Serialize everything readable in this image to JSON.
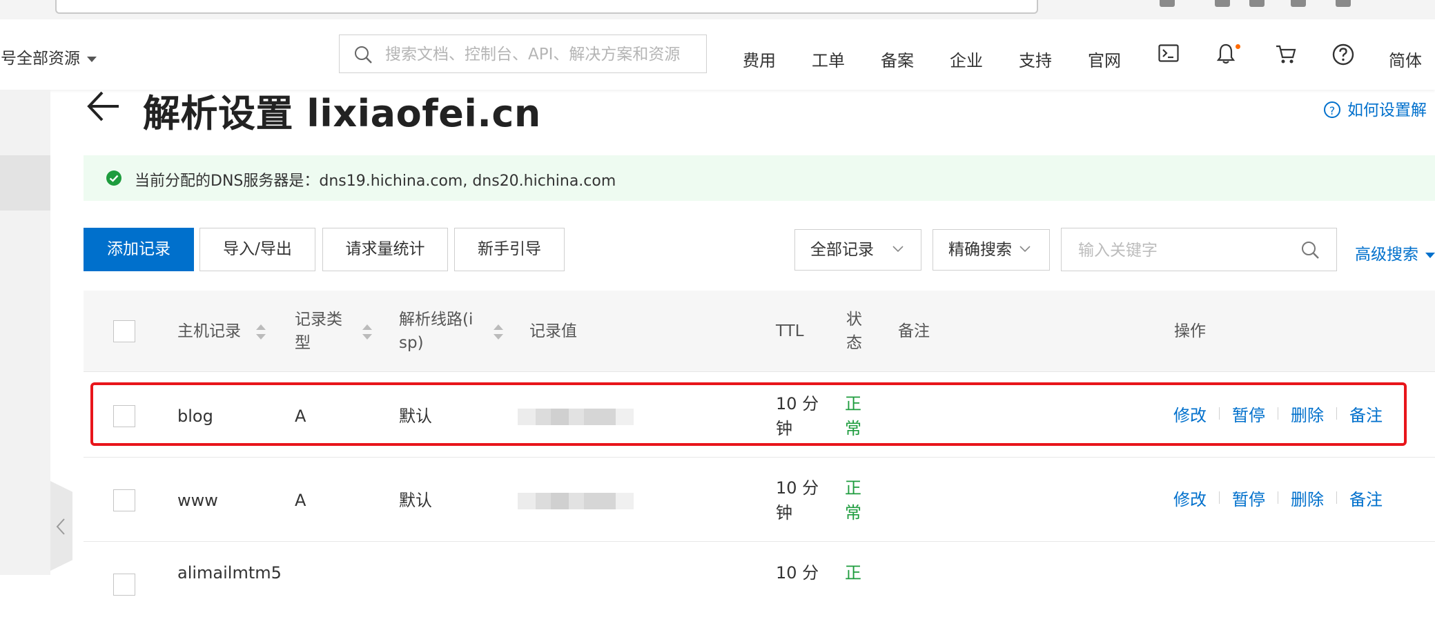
{
  "topbar": {
    "account_switch": "账号全部资源",
    "search_placeholder": "搜索文档、控制台、API、解决方案和资源",
    "nav": [
      "费用",
      "工单",
      "备案",
      "企业",
      "支持",
      "官网"
    ],
    "lang": "简体",
    "icons": [
      "terminal-icon",
      "bell-icon",
      "cart-icon",
      "help-icon"
    ]
  },
  "page": {
    "title": "解析设置 lixiaofei.cn",
    "help_link": "如何设置解",
    "notice": "当前分配的DNS服务器是：dns19.hichina.com, dns20.hichina.com"
  },
  "toolbar": {
    "add_record": "添加记录",
    "import_export": "导入/导出",
    "request_stats": "请求量统计",
    "beginner_guide": "新手引导",
    "record_filter": "全部记录",
    "search_mode": "精确搜索",
    "keyword_placeholder": "输入关键字",
    "advanced_search": "高级搜索"
  },
  "table": {
    "headers": {
      "host": "主机记录",
      "type_l1": "记录类",
      "type_l2": "型",
      "line_l1": "解析线路(i",
      "line_l2": "sp)",
      "value": "记录值",
      "ttl": "TTL",
      "status_l1": "状",
      "status_l2": "态",
      "remark": "备注",
      "actions": "操作"
    },
    "rows": [
      {
        "host": "blog",
        "type": "A",
        "line": "默认",
        "ttl_l1": "10 分",
        "ttl_l2": "钟",
        "status_l1": "正",
        "status_l2": "常"
      },
      {
        "host": "www",
        "type": "A",
        "line": "默认",
        "ttl_l1": "10 分",
        "ttl_l2": "钟",
        "status_l1": "正",
        "status_l2": "常"
      },
      {
        "host": "alimailmtm5",
        "type": "",
        "line": "",
        "ttl_l1": "10 分",
        "ttl_l2": "",
        "status_l1": "正",
        "status_l2": ""
      }
    ],
    "actions": {
      "modify": "修改",
      "pause": "暂停",
      "delete": "删除",
      "remark": "备注"
    }
  },
  "colors": {
    "accent": "#0070cc",
    "status_ok": "#1e9c3e",
    "highlight": "#e8151b",
    "notice_bg": "#eefbf1"
  }
}
